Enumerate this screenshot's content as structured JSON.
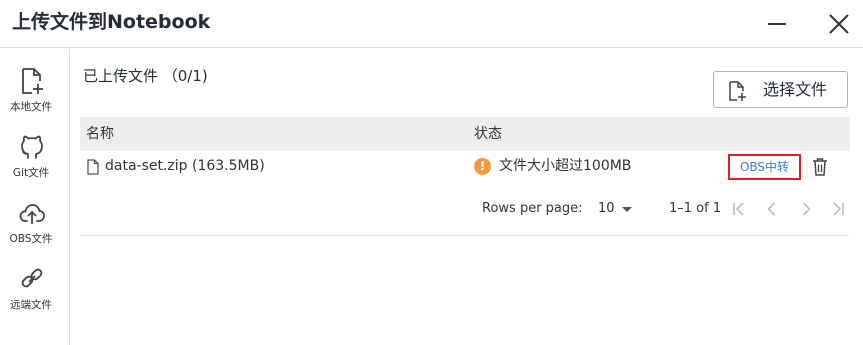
{
  "dialog": {
    "title": "上传文件到Notebook",
    "minimize_icon": "minimize-icon",
    "close_icon": "close-icon"
  },
  "sidebar": {
    "items": [
      {
        "label": "本地文件",
        "icon": "local-file-add-icon"
      },
      {
        "label": "Git文件",
        "icon": "github-icon"
      },
      {
        "label": "OBS文件",
        "icon": "cloud-upload-icon"
      },
      {
        "label": "远端文件",
        "icon": "link-icon"
      }
    ]
  },
  "main": {
    "uploaded_label": "已上传文件 （0/1)",
    "select_button": {
      "label": "选择文件",
      "icon": "file-add-icon"
    },
    "table": {
      "columns": [
        "名称",
        "状态"
      ],
      "rows": [
        {
          "name": "data-set.zip (163.5MB)",
          "status": "文件大小超过100MB",
          "status_icon": "warning-icon",
          "status_color": "#fa9841",
          "action_label": "OBS中转",
          "delete_icon": "trash-icon"
        }
      ]
    },
    "pagination": {
      "rows_per_page_label": "Rows per page:",
      "rows_per_page_value": "10",
      "range_text": "1–1 of 1"
    }
  },
  "colors": {
    "link": "#3a7fd5",
    "highlight_border": "#e02020",
    "warning": "#fa9841",
    "header_bg": "#eeeeee"
  }
}
